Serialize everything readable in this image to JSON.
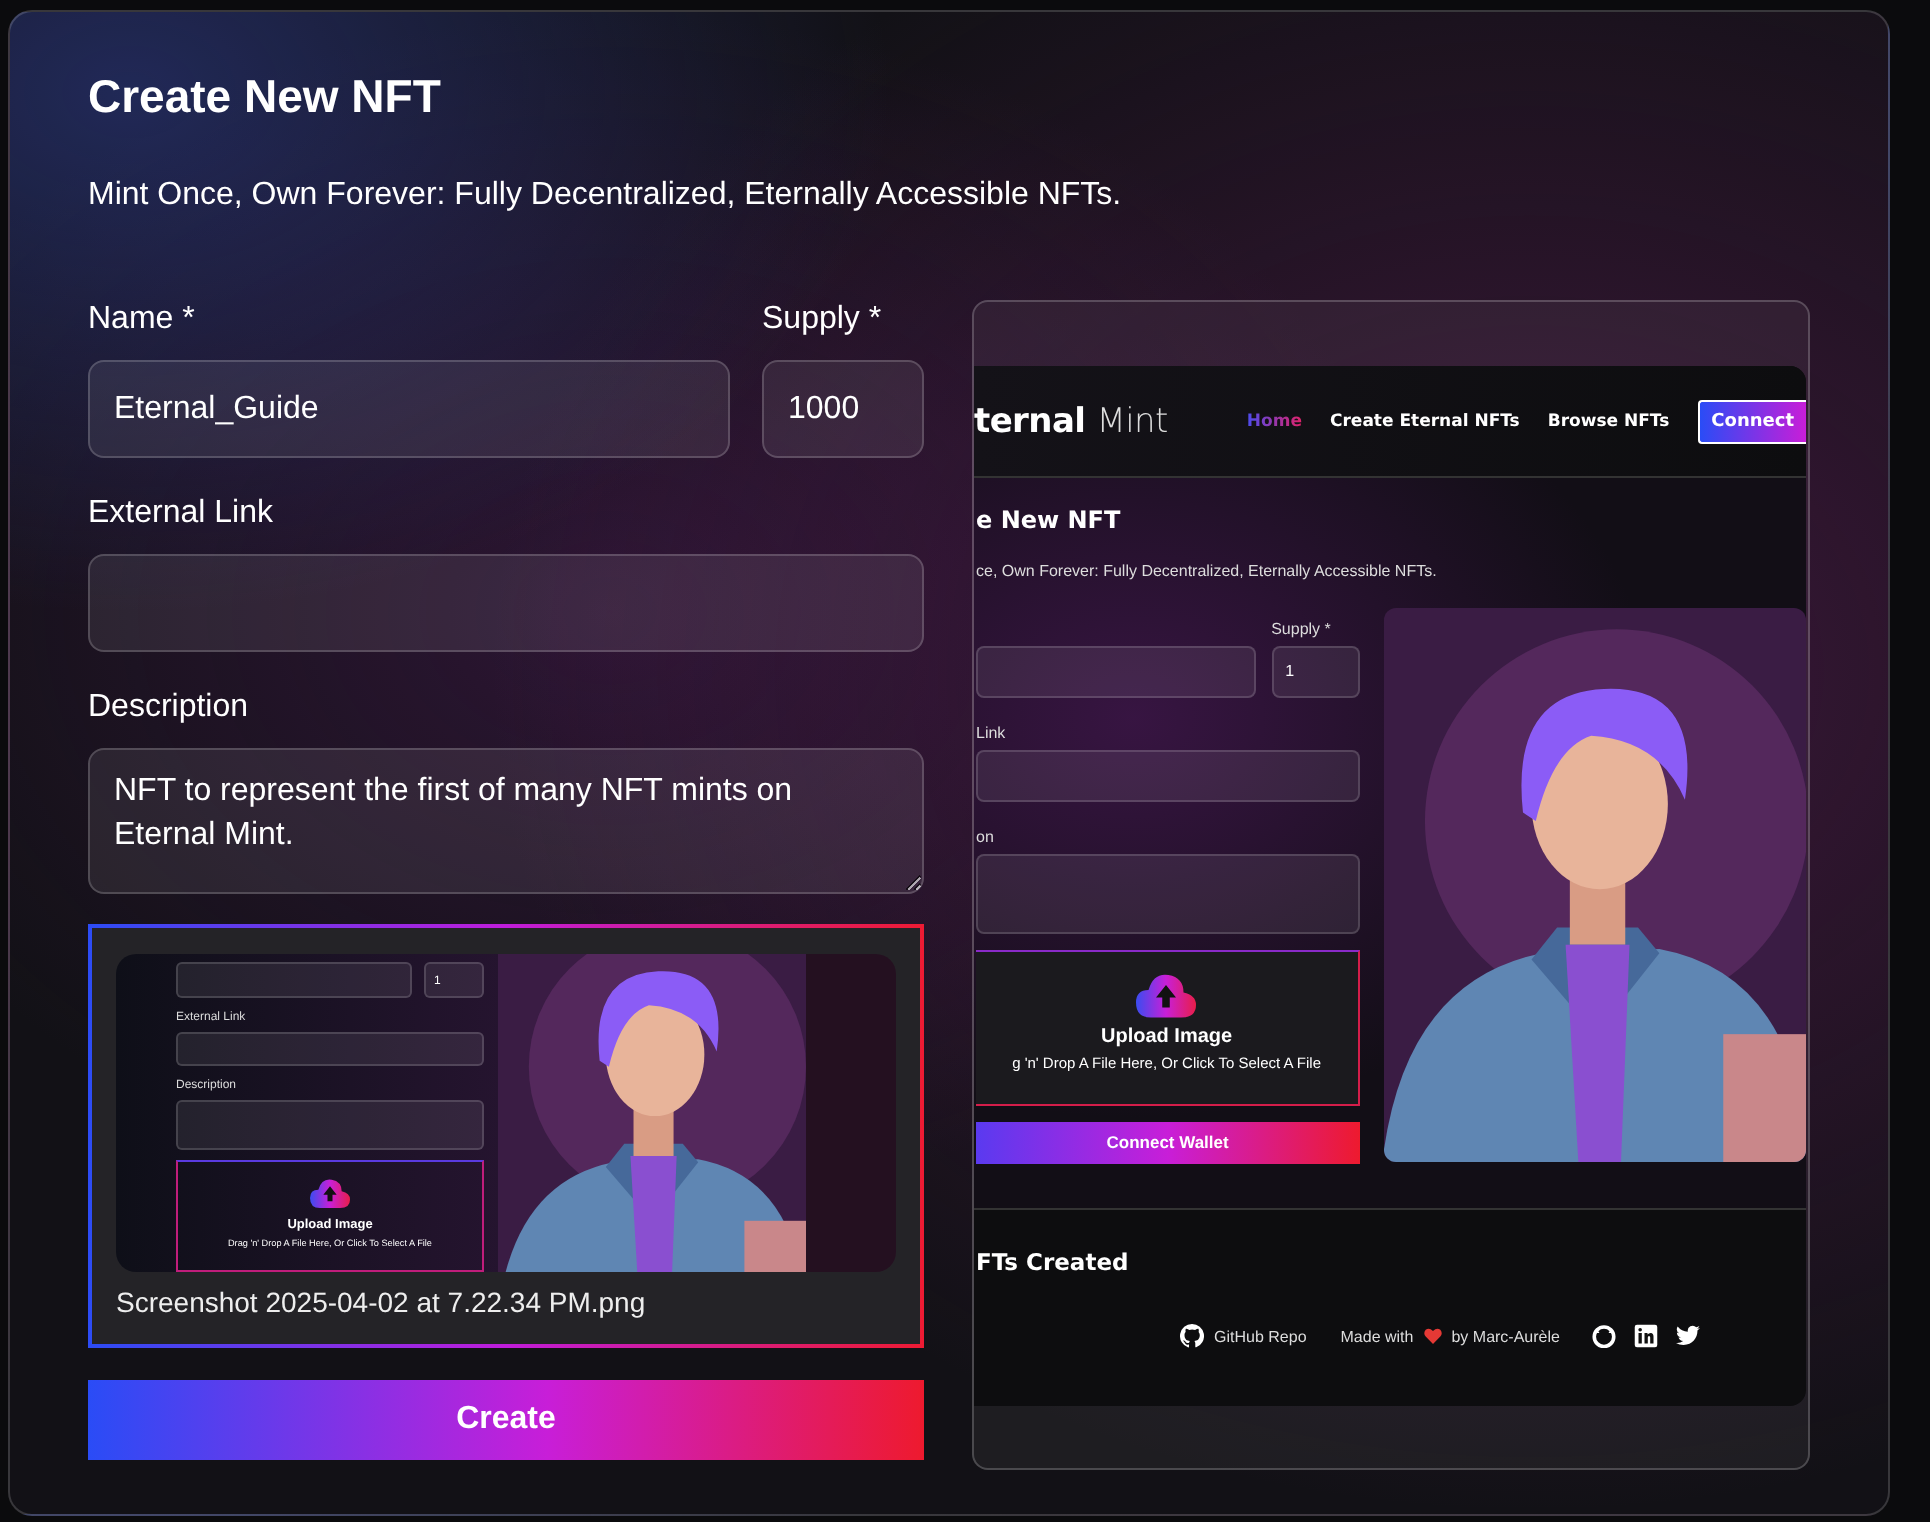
{
  "title": "Create New NFT",
  "subtitle": "Mint Once, Own Forever: Fully Decentralized, Eternally Accessible NFTs.",
  "name_field": {
    "label": "Name *",
    "value": "Eternal_Guide"
  },
  "supply_field": {
    "label": "Supply *",
    "value": "1000"
  },
  "external_link_field": {
    "label": "External Link"
  },
  "description_field": {
    "label": "Description",
    "value": "NFT to represent the first of many NFT mints on Eternal Mint."
  },
  "upload": {
    "filename": "Screenshot 2025-04-02 at 7.22.34 PM.png",
    "thumbnail": {
      "supply_value": "1",
      "link_label": "External Link",
      "description_label": "Description",
      "upload_title": "Upload Image",
      "upload_hint": "Drag 'n' Drop A File Here, Or Click To Select A File"
    }
  },
  "create_button": "Create",
  "preview": {
    "logo_bold": "ternal",
    "logo_light": "Mint",
    "nav": [
      {
        "label": "Home",
        "selected": true
      },
      {
        "label": "Create Eternal NFTs",
        "selected": false
      },
      {
        "label": "Browse NFTs",
        "selected": false
      }
    ],
    "connect_button": "Connect",
    "title": "e New NFT",
    "subtitle": "ce, Own Forever: Fully Decentralized, Eternally Accessible NFTs.",
    "supply_label": "Supply *",
    "supply_value": "1",
    "link_label": "Link",
    "description_label": "on",
    "upload_title": "Upload Image",
    "upload_hint": "g 'n' Drop A File Here, Or Click To Select A File",
    "connect_wallet": "Connect Wallet",
    "section_title": "FTs Created",
    "footer": {
      "repo": "GitHub Repo",
      "made_with": "Made with",
      "by": "by Marc-Aurèle"
    }
  }
}
